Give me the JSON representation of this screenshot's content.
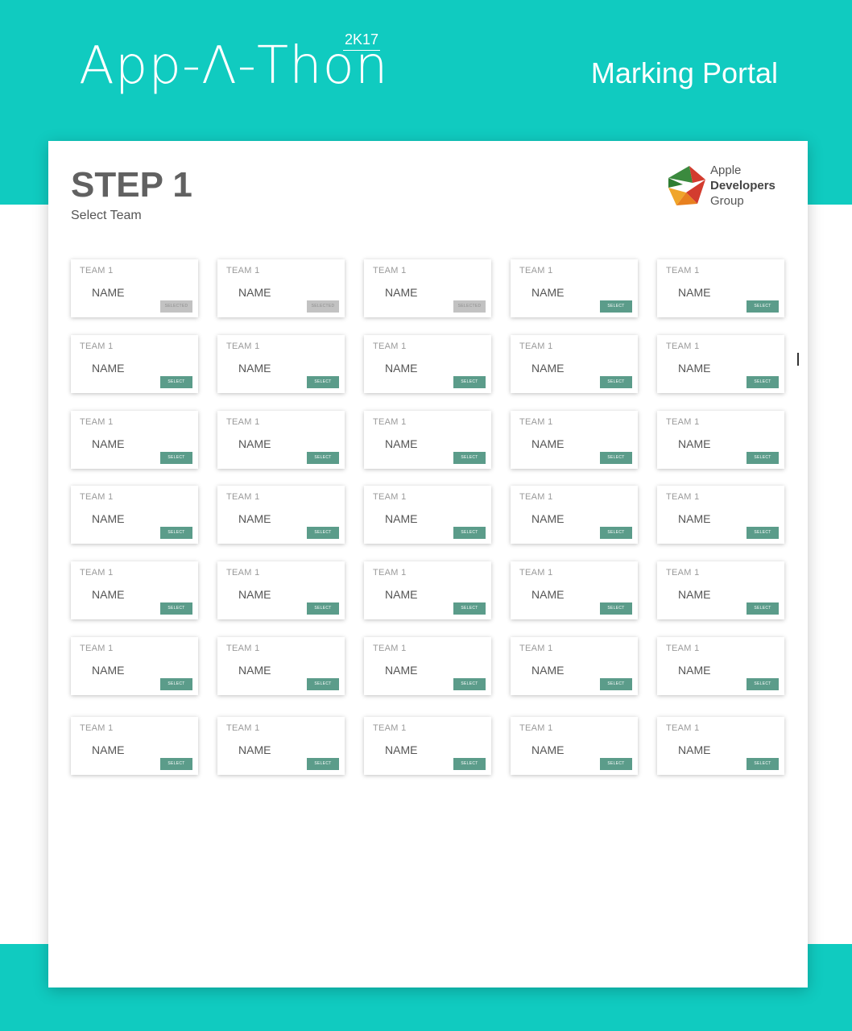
{
  "header": {
    "logo_text": "App-Λ-Thon",
    "logo_year": "2K17",
    "portal_title": "Marking Portal"
  },
  "step": {
    "title": "STEP 1",
    "subtitle": "Select Team"
  },
  "org_logo": {
    "line1": "Apple",
    "line2": "Developers",
    "line3": "Group"
  },
  "colors": {
    "brand_teal": "#10cbc0",
    "select_button": "#5b9c8a",
    "disabled_button": "#c2c2c2"
  },
  "grid": {
    "rows": [
      [
        {
          "team": "TEAM 1",
          "name": "NAME",
          "button": "SELECTED",
          "enabled": false
        },
        {
          "team": "TEAM 1",
          "name": "NAME",
          "button": "SELECTED",
          "enabled": false
        },
        {
          "team": "TEAM 1",
          "name": "NAME",
          "button": "SELECTED",
          "enabled": false
        },
        {
          "team": "TEAM 1",
          "name": "NAME",
          "button": "SELECT",
          "enabled": true
        },
        {
          "team": "TEAM 1",
          "name": "NAME",
          "button": "SELECT",
          "enabled": true
        }
      ],
      [
        {
          "team": "TEAM 1",
          "name": "NAME",
          "button": "SELECT",
          "enabled": true
        },
        {
          "team": "TEAM 1",
          "name": "NAME",
          "button": "SELECT",
          "enabled": true
        },
        {
          "team": "TEAM 1",
          "name": "NAME",
          "button": "SELECT",
          "enabled": true
        },
        {
          "team": "TEAM 1",
          "name": "NAME",
          "button": "SELECT",
          "enabled": true
        },
        {
          "team": "TEAM 1",
          "name": "NAME",
          "button": "SELECT",
          "enabled": true
        }
      ],
      [
        {
          "team": "TEAM 1",
          "name": "NAME",
          "button": "SELECT",
          "enabled": true
        },
        {
          "team": "TEAM 1",
          "name": "NAME",
          "button": "SELECT",
          "enabled": true
        },
        {
          "team": "TEAM 1",
          "name": "NAME",
          "button": "SELECT",
          "enabled": true
        },
        {
          "team": "TEAM 1",
          "name": "NAME",
          "button": "SELECT",
          "enabled": true
        },
        {
          "team": "TEAM 1",
          "name": "NAME",
          "button": "SELECT",
          "enabled": true
        }
      ],
      [
        {
          "team": "TEAM 1",
          "name": "NAME",
          "button": "SELECT",
          "enabled": true
        },
        {
          "team": "TEAM 1",
          "name": "NAME",
          "button": "SELECT",
          "enabled": true
        },
        {
          "team": "TEAM 1",
          "name": "NAME",
          "button": "SELECT",
          "enabled": true
        },
        {
          "team": "TEAM 1",
          "name": "NAME",
          "button": "SELECT",
          "enabled": true
        },
        {
          "team": "TEAM 1",
          "name": "NAME",
          "button": "SELECT",
          "enabled": true
        }
      ],
      [
        {
          "team": "TEAM 1",
          "name": "NAME",
          "button": "SELECT",
          "enabled": true
        },
        {
          "team": "TEAM 1",
          "name": "NAME",
          "button": "SELECT",
          "enabled": true
        },
        {
          "team": "TEAM 1",
          "name": "NAME",
          "button": "SELECT",
          "enabled": true
        },
        {
          "team": "TEAM 1",
          "name": "NAME",
          "button": "SELECT",
          "enabled": true
        },
        {
          "team": "TEAM 1",
          "name": "NAME",
          "button": "SELECT",
          "enabled": true
        }
      ],
      [
        {
          "team": "TEAM 1",
          "name": "NAME",
          "button": "SELECT",
          "enabled": true
        },
        {
          "team": "TEAM 1",
          "name": "NAME",
          "button": "SELECT",
          "enabled": true
        },
        {
          "team": "TEAM 1",
          "name": "NAME",
          "button": "SELECT",
          "enabled": true
        },
        {
          "team": "TEAM 1",
          "name": "NAME",
          "button": "SELECT",
          "enabled": true
        },
        {
          "team": "TEAM 1",
          "name": "NAME",
          "button": "SELECT",
          "enabled": true
        }
      ],
      [
        {
          "team": "TEAM 1",
          "name": "NAME",
          "button": "SELECT",
          "enabled": true
        },
        {
          "team": "TEAM 1",
          "name": "NAME",
          "button": "SELECT",
          "enabled": true
        },
        {
          "team": "TEAM 1",
          "name": "NAME",
          "button": "SELECT",
          "enabled": true
        },
        {
          "team": "TEAM 1",
          "name": "NAME",
          "button": "SELECT",
          "enabled": true
        },
        {
          "team": "TEAM 1",
          "name": "NAME",
          "button": "SELECT",
          "enabled": true
        }
      ]
    ]
  }
}
